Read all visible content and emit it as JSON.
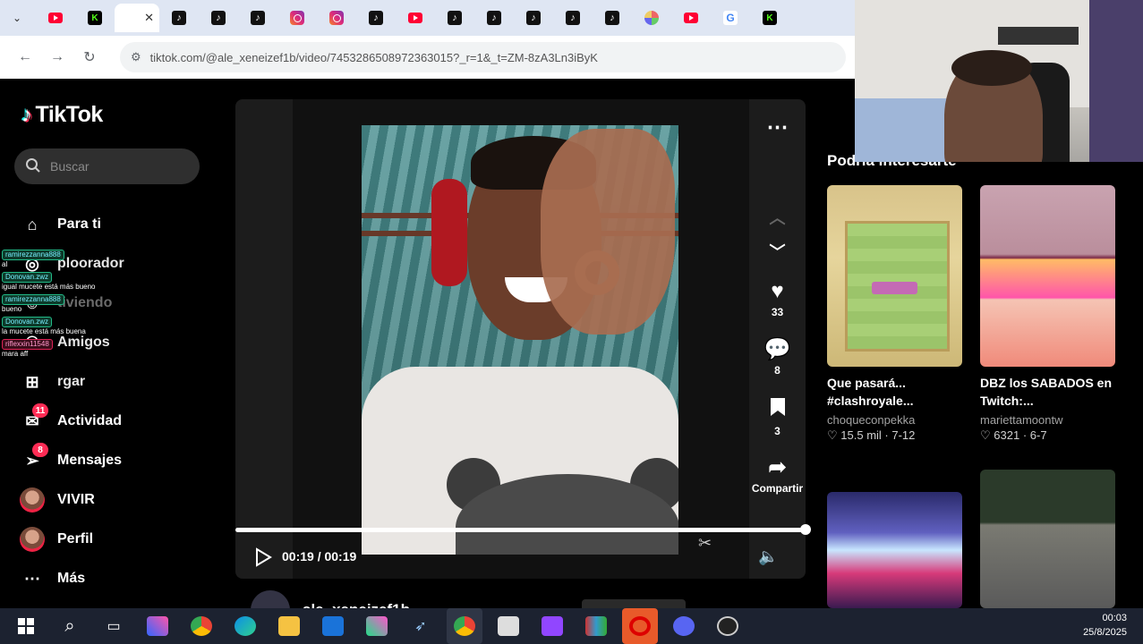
{
  "browser": {
    "url": "tiktok.com/@ale_xeneizef1b/video/7453286508972363015?_r=1&_t=ZM-8zA3Ln3iByK",
    "tabs": [
      "youtube",
      "kick",
      "tiktok",
      "tiktok",
      "tiktok",
      "tiktok",
      "instagram",
      "instagram",
      "tiktok",
      "youtube",
      "tiktok",
      "tiktok",
      "tiktok",
      "tiktok",
      "tiktok",
      "multi",
      "youtube",
      "google",
      "kick"
    ],
    "active_tab_close": "✕"
  },
  "sidebar": {
    "logo": "TikTok",
    "search_placeholder": "Buscar",
    "items": [
      {
        "label": "Para ti",
        "icon": "home-icon"
      },
      {
        "label": "ploorador",
        "icon": "compass-icon"
      },
      {
        "label": "tiviendo",
        "icon": "following-icon"
      },
      {
        "label": "Amigos",
        "icon": "friends-icon"
      },
      {
        "label": "rgar",
        "icon": "upload-icon"
      },
      {
        "label": "Actividad",
        "icon": "activity-icon",
        "badge": "11"
      },
      {
        "label": "Mensajes",
        "icon": "messages-icon",
        "badge": "8"
      },
      {
        "label": "VIVIR",
        "icon": "live-icon"
      },
      {
        "label": "Perfil",
        "icon": "profile-icon"
      },
      {
        "label": "Más",
        "icon": "more-icon"
      }
    ]
  },
  "chat": [
    {
      "user": "ramirezzanna888",
      "msg": "al",
      "style": "g"
    },
    {
      "user": "Donovan.zwz",
      "msg": "igual mucete está más bueno",
      "style": "g"
    },
    {
      "user": "ramirezzanna888",
      "msg": "bueno",
      "style": "g"
    },
    {
      "user": "Donovan.zwz",
      "msg": "la mucete está más buena",
      "style": "g"
    },
    {
      "user": "riflexxin11548",
      "msg": "mara aff",
      "style": "r"
    }
  ],
  "video": {
    "likes": "33",
    "comments": "8",
    "saves": "3",
    "share_label": "Compartir",
    "time": "00:19 / 00:19",
    "progress": 1.0,
    "author": "ale_xeneizef1b"
  },
  "suggested": {
    "title": "Podría interesarte",
    "cards": [
      {
        "title": "Que pasará... #clashroyale...",
        "user": "choqueconpekka",
        "likes": "15.5 mil",
        "date": "7-12",
        "thumb": "t-clash"
      },
      {
        "title": "DBZ los SABADOS en Twitch:...",
        "user": "mariettamoontw",
        "likes": "6321",
        "date": "6-7",
        "thumb": "t-dbz"
      },
      {
        "title": "",
        "user": "",
        "likes": "",
        "date": "",
        "thumb": "t-vegeta"
      },
      {
        "title": "",
        "user": "",
        "likes": "",
        "date": "",
        "thumb": "t-stream"
      }
    ]
  },
  "taskbar": {
    "time": "00:03",
    "date": "25/8/2025"
  }
}
